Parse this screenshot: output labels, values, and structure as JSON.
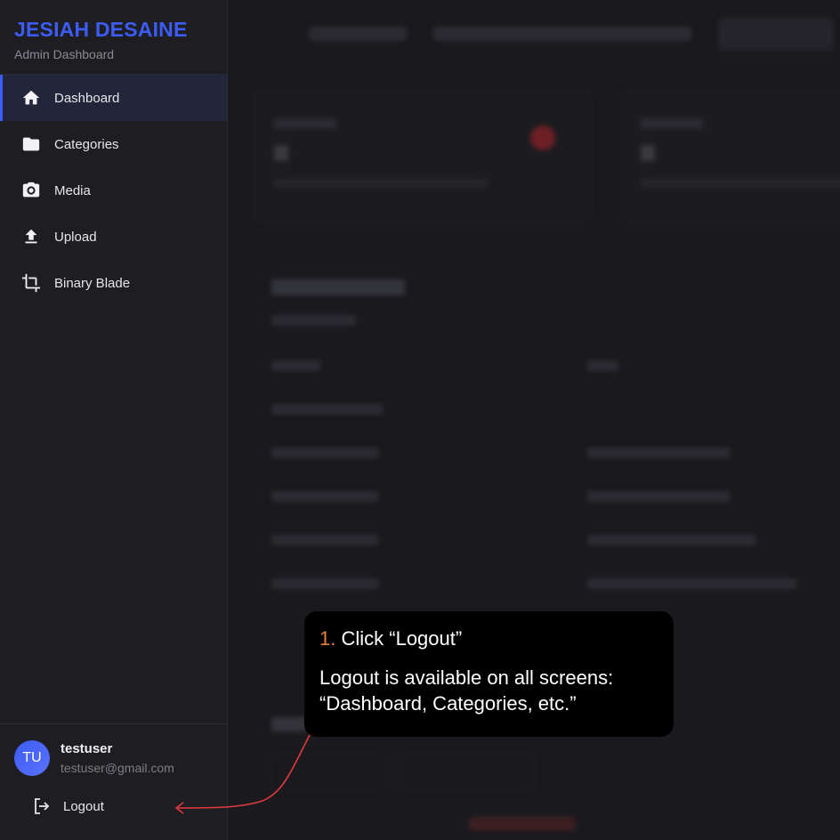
{
  "sidebar": {
    "brand_title": "JESIAH DESAINE",
    "brand_subtitle": "Admin Dashboard",
    "items": [
      {
        "label": "Dashboard",
        "icon": "home-icon",
        "active": true
      },
      {
        "label": "Categories",
        "icon": "folder-icon",
        "active": false
      },
      {
        "label": "Media",
        "icon": "camera-icon",
        "active": false
      },
      {
        "label": "Upload",
        "icon": "upload-icon",
        "active": false
      },
      {
        "label": "Binary Blade",
        "icon": "crop-icon",
        "active": false
      }
    ],
    "user": {
      "initials": "TU",
      "name": "testuser",
      "email": "testuser@gmail.com"
    },
    "logout_label": "Logout"
  },
  "tooltip": {
    "step_number": "1.",
    "step_title": "Click “Logout”",
    "body": "Logout is available on all screens: “Dashboard, Categories, etc.”"
  },
  "colors": {
    "accent": "#3d5cf5",
    "step_number": "#e8823a",
    "arrow": "#e0393c",
    "sidebar_bg": "#1d1d22"
  }
}
